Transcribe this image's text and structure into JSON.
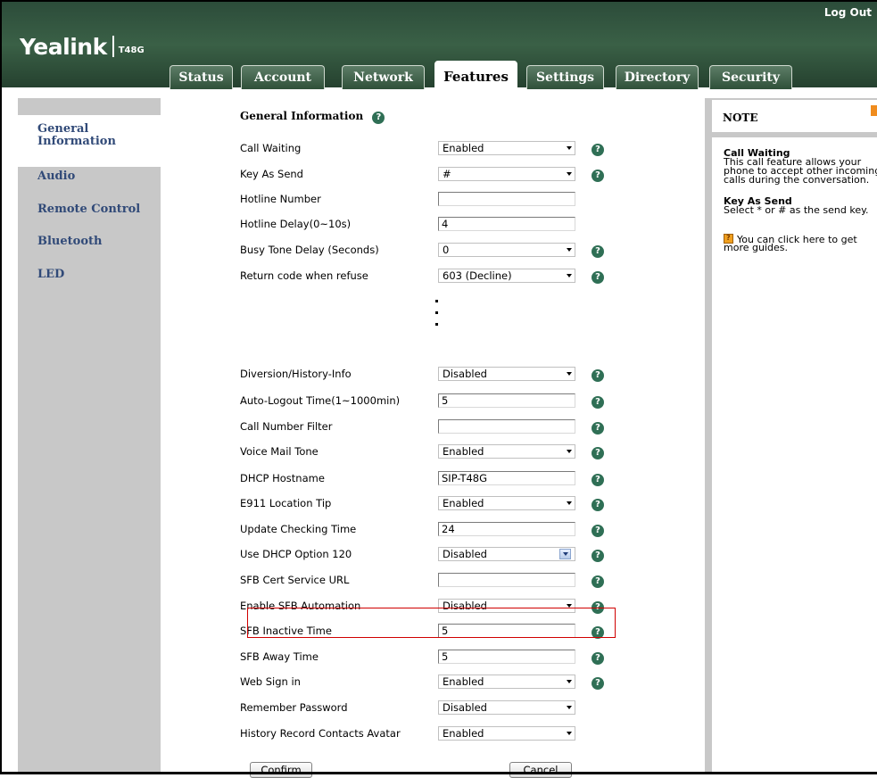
{
  "header": {
    "logout": "Log Out",
    "brand": "Yealink",
    "model": "T48G"
  },
  "tabs": [
    {
      "label": "Status",
      "active": false
    },
    {
      "label": "Account",
      "active": false
    },
    {
      "label": "Network",
      "active": false
    },
    {
      "label": "Features",
      "active": true
    },
    {
      "label": "Settings",
      "active": false
    },
    {
      "label": "Directory",
      "active": false
    },
    {
      "label": "Security",
      "active": false
    }
  ],
  "sidebar": {
    "items": [
      {
        "label_line1": "General",
        "label_line2": "Information",
        "selected": true
      },
      {
        "label": "Audio"
      },
      {
        "label": "Remote Control"
      },
      {
        "label": "Bluetooth"
      },
      {
        "label": "LED"
      }
    ]
  },
  "form": {
    "section_title": "General Information",
    "rows_top": [
      {
        "label": "Call Waiting",
        "type": "select",
        "value": "Enabled",
        "help": true
      },
      {
        "label": "Key As Send",
        "type": "select",
        "value": "#",
        "help": true
      },
      {
        "label": "Hotline Number",
        "type": "text",
        "value": "",
        "help": false
      },
      {
        "label": "Hotline Delay(0~10s)",
        "type": "text",
        "value": "4",
        "help": false
      },
      {
        "label": "Busy Tone Delay (Seconds)",
        "type": "select",
        "value": "0",
        "help": true
      },
      {
        "label": "Return code when refuse",
        "type": "select",
        "value": "603 (Decline)",
        "help": true
      }
    ],
    "rows_bottom": [
      {
        "label": "Diversion/History-Info",
        "type": "select",
        "value": "Disabled",
        "help": true
      },
      {
        "label": "Auto-Logout Time(1~1000min)",
        "type": "text",
        "value": "5",
        "help": true
      },
      {
        "label": "Call Number Filter",
        "type": "text",
        "value": "",
        "help": true
      },
      {
        "label": "Voice Mail Tone",
        "type": "select",
        "value": "Enabled",
        "help": true
      },
      {
        "label": "DHCP Hostname",
        "type": "text",
        "value": "SIP-T48G",
        "help": true
      },
      {
        "label": "E911 Location Tip",
        "type": "select",
        "value": "Enabled",
        "help": true
      },
      {
        "label": "Update Checking Time",
        "type": "text",
        "value": "24",
        "help": true
      },
      {
        "label": "Use DHCP Option 120",
        "type": "select2",
        "value": "Disabled",
        "help": true
      },
      {
        "label": "SFB Cert Service URL",
        "type": "text",
        "value": "",
        "help": true
      },
      {
        "label": "Enable SFB Automation",
        "type": "select",
        "value": "Disabled",
        "help": true
      },
      {
        "label": "SFB Inactive Time",
        "type": "text",
        "value": "5",
        "help": true
      },
      {
        "label": "SFB Away Time",
        "type": "text",
        "value": "5",
        "help": true
      },
      {
        "label": "Web Sign in",
        "type": "select",
        "value": "Enabled",
        "help": true
      },
      {
        "label": "Remember Password",
        "type": "select",
        "value": "Disabled",
        "help": false
      },
      {
        "label": "History Record Contacts Avatar",
        "type": "select",
        "value": "Enabled",
        "help": false
      }
    ],
    "confirm_label": "Confirm",
    "cancel_label": "Cancel",
    "help_glyph": "?"
  },
  "note": {
    "title": "NOTE",
    "call_waiting_title": "Call Waiting",
    "call_waiting_lines": [
      "This call feature allows your",
      "phone to accept other incoming",
      "calls during the conversation."
    ],
    "key_as_send_title": "Key As Send",
    "key_as_send_text": "Select * or # as the send key.",
    "guide_lines": [
      "You can click here to get",
      "more guides."
    ]
  }
}
